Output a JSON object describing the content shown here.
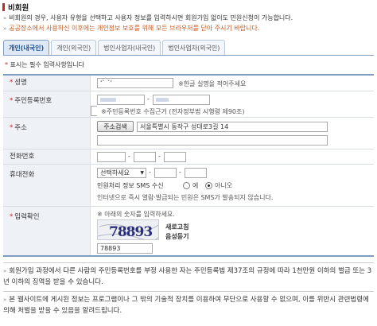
{
  "title": "비회원",
  "notices": [
    "비회원의 경우, 사용자 유형을 선택하고 사용자 정보를 입력하시면 회원가입 없이도 민원신청이 가능합니다.",
    "공공장소에서 사용하신 이후에는 개인정보 보호를 위해 모든 브라우저를 닫아 주시기 바랍니다."
  ],
  "tabs": [
    "개인(내국인)",
    "개인(외국인)",
    "법인사업자(내국인)",
    "법인사업자(외국인)"
  ],
  "required_note": {
    "prefix": "* ",
    "text": "표시는 필수 입력사항입니다"
  },
  "form": {
    "name": {
      "label": "성명",
      "value": "'` `'",
      "hint": "※한글 실명을 적어주세요"
    },
    "rrn": {
      "label": "주민등록번호",
      "value1": "",
      "value2": "",
      "hint": "※주민등록번호 수집근거 (전자정부법 시행령 제90조)"
    },
    "address": {
      "label": "주소",
      "button": "주소검색",
      "line1": "서울특별시 동작구 성대로3길 14",
      "line2": ""
    },
    "phone": {
      "label": "전화번호",
      "dash": "-"
    },
    "mobile": {
      "label": "휴대전화",
      "select": "선택하세요",
      "sms_label": "민원처리 정보 SMS 수신",
      "yes": "예",
      "no": "아니오",
      "hint": "인터넷으로 즉시 열람·발급되는 민원은 SMS가 발송되지 않습니다."
    },
    "captcha": {
      "label": "입력확인",
      "hint": "※ 아래의 숫자를 입력하세요.",
      "image_text": "78893",
      "refresh": "새로고침",
      "audio": "음성듣기",
      "value": "78893"
    }
  },
  "warnings": [
    "회원가입 과정에서 다른 사람의 주민등록번호를 부정 사용한 자는 주민등록법 제37조의 규정에 따라 1천만원 이하의 벌금 또는 3년 이하의 징역을 받을 수 있습니다.",
    "본 웹사이트에 게시된 정보는 프로그램이나 그 밖의 기술적 장치를 이용하여 무단으로 사용할 수 없으며, 이를 위반시 관련법령에 의해 처벌을 받을 수 있음을 알려드립니다."
  ],
  "colors": {
    "accent": "#c62828",
    "notice_orange": "#c9581e",
    "tab_border": "#7f9cc2",
    "label_bg": "#eef2f7"
  }
}
